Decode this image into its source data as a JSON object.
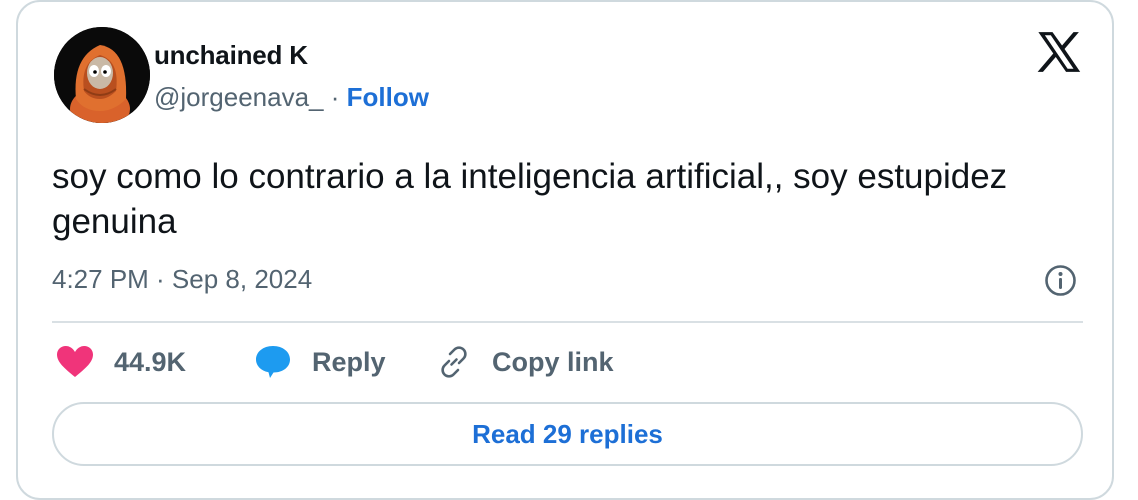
{
  "author": {
    "display_name": "unchained K",
    "handle": "@jorgeenava_",
    "separator": "·",
    "follow_label": "Follow"
  },
  "tweet": {
    "text": "soy como lo contrario a la inteligencia artificial,, soy estupidez genuina",
    "timestamp": "4:27 PM · Sep 8, 2024"
  },
  "actions": {
    "like_count": "44.9K",
    "reply_label": "Reply",
    "copy_label": "Copy link"
  },
  "footer": {
    "read_replies_label": "Read 29 replies"
  },
  "icons": {
    "brand": "x-logo-icon",
    "info": "info-icon",
    "like": "heart-icon",
    "reply": "speech-bubble-icon",
    "copy": "link-icon"
  },
  "colors": {
    "accent": "#1d6fd6",
    "like": "#f0347a",
    "reply": "#1d9bf0",
    "muted": "#536471",
    "text": "#0f1419",
    "border": "#cfd9de"
  }
}
